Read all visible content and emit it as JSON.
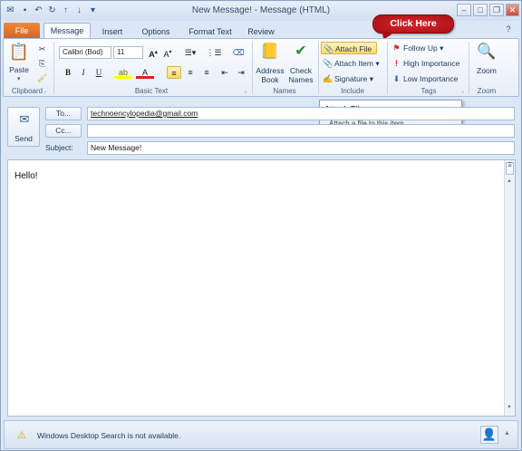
{
  "window": {
    "title": "New Message! - Message (HTML)"
  },
  "tabs": {
    "file": "File",
    "items": [
      "Message",
      "Insert",
      "Options",
      "Format Text",
      "Review"
    ]
  },
  "ribbon": {
    "clipboard": {
      "paste": "Paste",
      "label": "Clipboard"
    },
    "basic_text": {
      "font": "Calibri (Bod)",
      "size": "11",
      "bold": "B",
      "italic": "I",
      "underline": "U",
      "label": "Basic Text"
    },
    "names": {
      "address_book": "Address Book",
      "check_names": "Check Names",
      "label": "Names"
    },
    "include": {
      "attach_file": "Attach File",
      "attach_item": "Attach Item",
      "signature": "Signature",
      "label": "Include"
    },
    "tags": {
      "follow_up": "Follow Up",
      "high_importance": "High Importance",
      "low_importance": "Low Importance",
      "label": "Tags"
    },
    "zoom": {
      "button": "Zoom",
      "label": "Zoom"
    }
  },
  "callout": "Click Here",
  "tooltip": {
    "title": "Attach File",
    "description": "Attach a file to this item."
  },
  "header": {
    "send": "Send",
    "to_label": "To...",
    "to_value": "technoencylopedia@gmail.com",
    "cc_label": "Cc...",
    "cc_value": "",
    "subject_label": "Subject:",
    "subject_value": "New Message!"
  },
  "body": {
    "text": "Hello!"
  },
  "status": {
    "message": "Windows Desktop Search is not available."
  },
  "colors": {
    "file_tab": "#e46c1e",
    "callout": "#c41a1f",
    "highlight": "#ffd966"
  }
}
